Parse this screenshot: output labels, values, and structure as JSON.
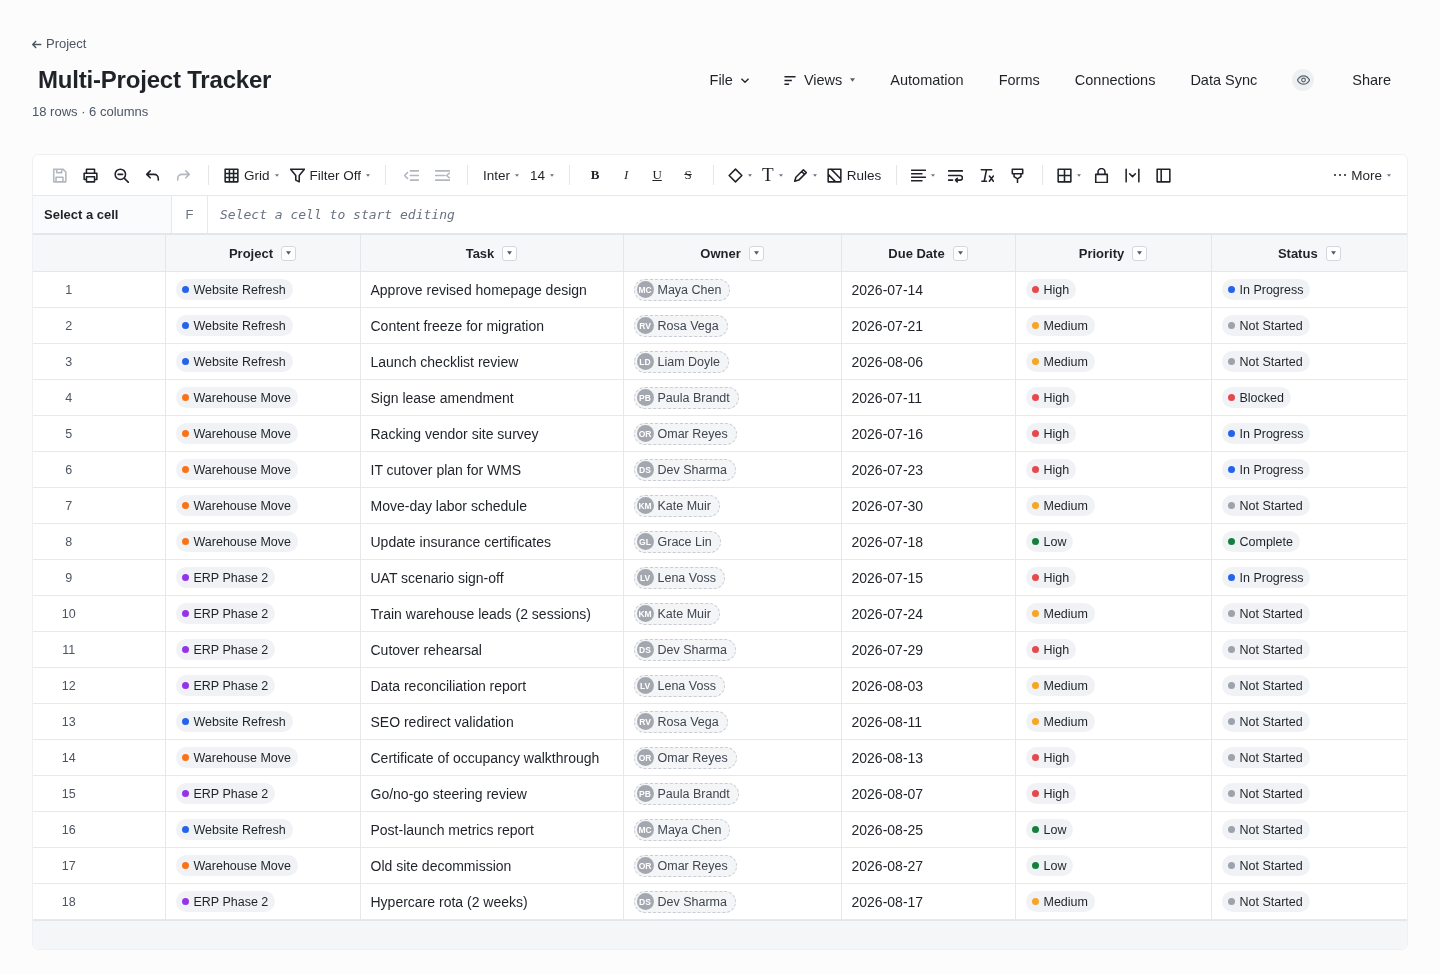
{
  "back_link": {
    "label": "Project"
  },
  "title": "Multi-Project Tracker",
  "subtitle": "18 rows · 6 columns",
  "nav": [
    {
      "kind": "dropdown",
      "label": "File"
    },
    {
      "kind": "picker",
      "label": "Views"
    },
    {
      "kind": "link",
      "label": "Automation"
    },
    {
      "kind": "link",
      "label": "Forms"
    },
    {
      "kind": "link",
      "label": "Connections"
    },
    {
      "kind": "link",
      "label": "Data Sync"
    },
    {
      "kind": "preview"
    },
    {
      "kind": "link",
      "label": "Share"
    }
  ],
  "toolbar": {
    "groups": [
      [
        {
          "kind": "save",
          "disabled": true,
          "menu": false
        },
        {
          "kind": "print",
          "disabled": false,
          "menu": false
        },
        {
          "kind": "zoom",
          "disabled": false,
          "menu": false
        },
        {
          "kind": "undo",
          "disabled": false,
          "menu": false
        },
        {
          "kind": "redo",
          "disabled": true,
          "menu": false
        }
      ],
      [
        {
          "kind": "view",
          "label": "Grid",
          "disabled": false,
          "menu": true
        },
        {
          "kind": "filter",
          "label": "Filter Off",
          "disabled": false,
          "menu": true
        }
      ],
      [
        {
          "kind": "outdent",
          "disabled": true,
          "menu": false
        },
        {
          "kind": "indent",
          "disabled": true,
          "menu": false
        }
      ],
      [
        {
          "kind": "font",
          "label": "Inter",
          "disabled": false,
          "menu": true
        },
        {
          "kind": "size",
          "label": "14",
          "disabled": false,
          "menu": true
        }
      ],
      [
        {
          "kind": "bold",
          "label": "B",
          "disabled": false,
          "menu": false
        },
        {
          "kind": "italic",
          "label": "I",
          "disabled": false,
          "menu": false
        },
        {
          "kind": "underline",
          "label": "U",
          "disabled": false,
          "menu": false
        },
        {
          "kind": "strike",
          "label": "S",
          "disabled": false,
          "menu": false
        }
      ],
      [
        {
          "kind": "fill",
          "disabled": false,
          "menu": true
        },
        {
          "kind": "textstyle",
          "label": "T",
          "disabled": false,
          "menu": true
        },
        {
          "kind": "draw",
          "disabled": false,
          "menu": true
        },
        {
          "kind": "rules",
          "label": "Rules",
          "disabled": false,
          "menu": false
        }
      ],
      [
        {
          "kind": "align",
          "disabled": false,
          "menu": true
        },
        {
          "kind": "wrap",
          "disabled": false,
          "menu": false
        },
        {
          "kind": "clear",
          "disabled": false,
          "menu": false
        },
        {
          "kind": "paint",
          "disabled": false,
          "menu": false
        }
      ],
      [
        {
          "kind": "borders",
          "disabled": false,
          "menu": true
        },
        {
          "kind": "lock",
          "disabled": false,
          "menu": false
        },
        {
          "kind": "resize",
          "disabled": false,
          "menu": false
        },
        {
          "kind": "freeze",
          "disabled": false,
          "menu": false
        }
      ]
    ],
    "end": [
      {
        "kind": "more",
        "label": "More",
        "disabled": false,
        "menu": true
      }
    ]
  },
  "formula_bar": {
    "cell_reference": "Select a cell",
    "function_label": "F",
    "placeholder": "Select a cell to start editing"
  },
  "table": {
    "columns": [
      {
        "label": "Project"
      },
      {
        "label": "Task"
      },
      {
        "label": "Owner"
      },
      {
        "label": "Due Date"
      },
      {
        "label": "Priority"
      },
      {
        "label": "Status"
      }
    ],
    "rows": [
      {
        "number": "1",
        "project": {
          "label": "Website Refresh",
          "color": "#2563eb"
        },
        "task": "Approve revised homepage design",
        "owner": {
          "initials": "MC",
          "name": "Maya Chen"
        },
        "due_date": "2026-07-14",
        "priority": {
          "label": "High",
          "color": "#e5484d"
        },
        "status": {
          "label": "In Progress",
          "color": "#2563eb"
        }
      },
      {
        "number": "2",
        "project": {
          "label": "Website Refresh",
          "color": "#2563eb"
        },
        "task": "Content freeze for migration",
        "owner": {
          "initials": "RV",
          "name": "Rosa Vega"
        },
        "due_date": "2026-07-21",
        "priority": {
          "label": "Medium",
          "color": "#f5a623"
        },
        "status": {
          "label": "Not Started",
          "color": "#9ca3af"
        }
      },
      {
        "number": "3",
        "project": {
          "label": "Website Refresh",
          "color": "#2563eb"
        },
        "task": "Launch checklist review",
        "owner": {
          "initials": "LD",
          "name": "Liam Doyle"
        },
        "due_date": "2026-08-06",
        "priority": {
          "label": "Medium",
          "color": "#f5a623"
        },
        "status": {
          "label": "Not Started",
          "color": "#9ca3af"
        }
      },
      {
        "number": "4",
        "project": {
          "label": "Warehouse Move",
          "color": "#f97316"
        },
        "task": "Sign lease amendment",
        "owner": {
          "initials": "PB",
          "name": "Paula Brandt"
        },
        "due_date": "2026-07-11",
        "priority": {
          "label": "High",
          "color": "#e5484d"
        },
        "status": {
          "label": "Blocked",
          "color": "#e5484d"
        }
      },
      {
        "number": "5",
        "project": {
          "label": "Warehouse Move",
          "color": "#f97316"
        },
        "task": "Racking vendor site survey",
        "owner": {
          "initials": "OR",
          "name": "Omar Reyes"
        },
        "due_date": "2026-07-16",
        "priority": {
          "label": "High",
          "color": "#e5484d"
        },
        "status": {
          "label": "In Progress",
          "color": "#2563eb"
        }
      },
      {
        "number": "6",
        "project": {
          "label": "Warehouse Move",
          "color": "#f97316"
        },
        "task": "IT cutover plan for WMS",
        "owner": {
          "initials": "DS",
          "name": "Dev Sharma"
        },
        "due_date": "2026-07-23",
        "priority": {
          "label": "High",
          "color": "#e5484d"
        },
        "status": {
          "label": "In Progress",
          "color": "#2563eb"
        }
      },
      {
        "number": "7",
        "project": {
          "label": "Warehouse Move",
          "color": "#f97316"
        },
        "task": "Move-day labor schedule",
        "owner": {
          "initials": "KM",
          "name": "Kate Muir"
        },
        "due_date": "2026-07-30",
        "priority": {
          "label": "Medium",
          "color": "#f5a623"
        },
        "status": {
          "label": "Not Started",
          "color": "#9ca3af"
        }
      },
      {
        "number": "8",
        "project": {
          "label": "Warehouse Move",
          "color": "#f97316"
        },
        "task": "Update insurance certificates",
        "owner": {
          "initials": "GL",
          "name": "Grace Lin"
        },
        "due_date": "2026-07-18",
        "priority": {
          "label": "Low",
          "color": "#15803d"
        },
        "status": {
          "label": "Complete",
          "color": "#15803d"
        }
      },
      {
        "number": "9",
        "project": {
          "label": "ERP Phase 2",
          "color": "#9333ea"
        },
        "task": "UAT scenario sign-off",
        "owner": {
          "initials": "LV",
          "name": "Lena Voss"
        },
        "due_date": "2026-07-15",
        "priority": {
          "label": "High",
          "color": "#e5484d"
        },
        "status": {
          "label": "In Progress",
          "color": "#2563eb"
        }
      },
      {
        "number": "10",
        "project": {
          "label": "ERP Phase 2",
          "color": "#9333ea"
        },
        "task": "Train warehouse leads (2 sessions)",
        "owner": {
          "initials": "KM",
          "name": "Kate Muir"
        },
        "due_date": "2026-07-24",
        "priority": {
          "label": "Medium",
          "color": "#f5a623"
        },
        "status": {
          "label": "Not Started",
          "color": "#9ca3af"
        }
      },
      {
        "number": "11",
        "project": {
          "label": "ERP Phase 2",
          "color": "#9333ea"
        },
        "task": "Cutover rehearsal",
        "owner": {
          "initials": "DS",
          "name": "Dev Sharma"
        },
        "due_date": "2026-07-29",
        "priority": {
          "label": "High",
          "color": "#e5484d"
        },
        "status": {
          "label": "Not Started",
          "color": "#9ca3af"
        }
      },
      {
        "number": "12",
        "project": {
          "label": "ERP Phase 2",
          "color": "#9333ea"
        },
        "task": "Data reconciliation report",
        "owner": {
          "initials": "LV",
          "name": "Lena Voss"
        },
        "due_date": "2026-08-03",
        "priority": {
          "label": "Medium",
          "color": "#f5a623"
        },
        "status": {
          "label": "Not Started",
          "color": "#9ca3af"
        }
      },
      {
        "number": "13",
        "project": {
          "label": "Website Refresh",
          "color": "#2563eb"
        },
        "task": "SEO redirect validation",
        "owner": {
          "initials": "RV",
          "name": "Rosa Vega"
        },
        "due_date": "2026-08-11",
        "priority": {
          "label": "Medium",
          "color": "#f5a623"
        },
        "status": {
          "label": "Not Started",
          "color": "#9ca3af"
        }
      },
      {
        "number": "14",
        "project": {
          "label": "Warehouse Move",
          "color": "#f97316"
        },
        "task": "Certificate of occupancy walkthrough",
        "owner": {
          "initials": "OR",
          "name": "Omar Reyes"
        },
        "due_date": "2026-08-13",
        "priority": {
          "label": "High",
          "color": "#e5484d"
        },
        "status": {
          "label": "Not Started",
          "color": "#9ca3af"
        }
      },
      {
        "number": "15",
        "project": {
          "label": "ERP Phase 2",
          "color": "#9333ea"
        },
        "task": "Go/no-go steering review",
        "owner": {
          "initials": "PB",
          "name": "Paula Brandt"
        },
        "due_date": "2026-08-07",
        "priority": {
          "label": "High",
          "color": "#e5484d"
        },
        "status": {
          "label": "Not Started",
          "color": "#9ca3af"
        }
      },
      {
        "number": "16",
        "project": {
          "label": "Website Refresh",
          "color": "#2563eb"
        },
        "task": "Post-launch metrics report",
        "owner": {
          "initials": "MC",
          "name": "Maya Chen"
        },
        "due_date": "2026-08-25",
        "priority": {
          "label": "Low",
          "color": "#15803d"
        },
        "status": {
          "label": "Not Started",
          "color": "#9ca3af"
        }
      },
      {
        "number": "17",
        "project": {
          "label": "Warehouse Move",
          "color": "#f97316"
        },
        "task": "Old site decommission",
        "owner": {
          "initials": "OR",
          "name": "Omar Reyes"
        },
        "due_date": "2026-08-27",
        "priority": {
          "label": "Low",
          "color": "#15803d"
        },
        "status": {
          "label": "Not Started",
          "color": "#9ca3af"
        }
      },
      {
        "number": "18",
        "project": {
          "label": "ERP Phase 2",
          "color": "#9333ea"
        },
        "task": "Hypercare rota (2 weeks)",
        "owner": {
          "initials": "DS",
          "name": "Dev Sharma"
        },
        "due_date": "2026-08-17",
        "priority": {
          "label": "Medium",
          "color": "#f5a623"
        },
        "status": {
          "label": "Not Started",
          "color": "#9ca3af"
        }
      }
    ]
  }
}
